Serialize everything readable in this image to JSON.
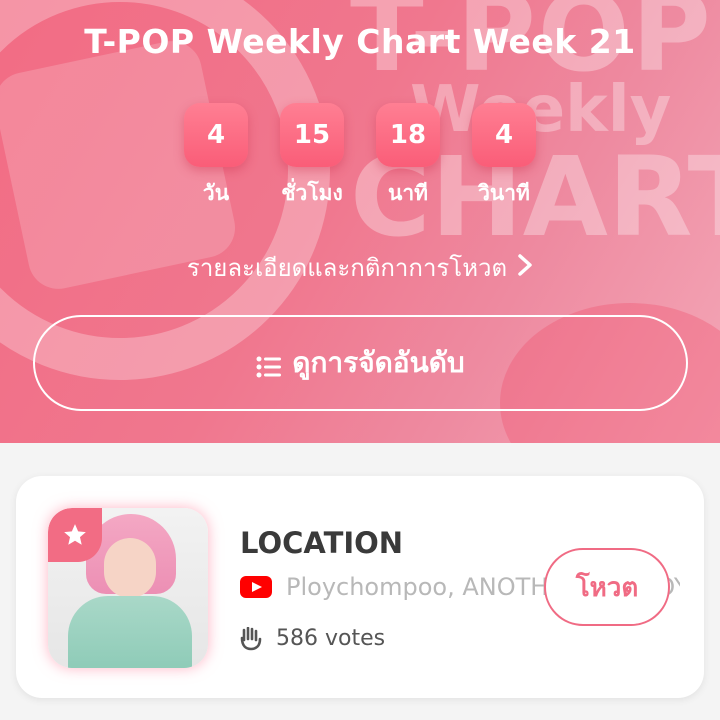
{
  "header": {
    "title": "T-POP Weekly Chart Week 21",
    "bg_text": [
      "T-POP",
      "Weekly",
      "CHART"
    ]
  },
  "countdown": [
    {
      "value": "4",
      "label": "วัน"
    },
    {
      "value": "15",
      "label": "ชั่วโมง"
    },
    {
      "value": "18",
      "label": "นาที"
    },
    {
      "value": "4",
      "label": "วินาที"
    }
  ],
  "rules_link": {
    "label": "รายละเอียดและกติกาการโหวต",
    "icon": "chevron-right-icon"
  },
  "ranking_button": {
    "label": "ดูการจัดอันดับ",
    "icon": "list-icon"
  },
  "song": {
    "title": "LOCATION",
    "artist": "Ploychompoo, ANOTHER SKY BOY-U",
    "votes": "586 votes",
    "platform_icon": "youtube-icon",
    "badge_icon": "star-icon",
    "vote_label": "โหวต"
  },
  "colors": {
    "accent": "#f26c84",
    "countdown_box": "#fa5d78",
    "youtube": "#ff0000"
  }
}
